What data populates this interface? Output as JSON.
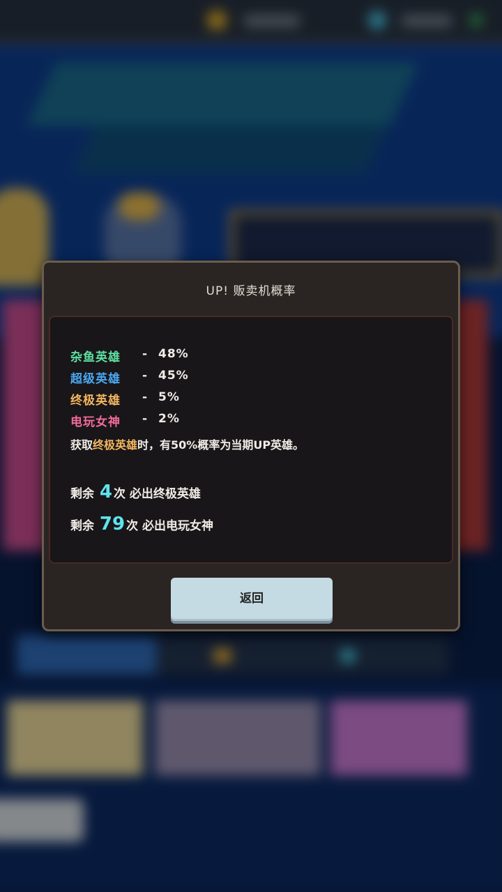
{
  "dialog": {
    "title": "UP! 贩卖机概率",
    "rates": [
      {
        "name": "杂鱼英雄",
        "dash": "-",
        "value": "48%",
        "color": "#5ee0a1"
      },
      {
        "name": "超级英雄",
        "dash": "-",
        "value": "45%",
        "color": "#4aa8f0"
      },
      {
        "name": "终极英雄",
        "dash": "-",
        "value": "5%",
        "color": "#f3b560"
      },
      {
        "name": "电玩女神",
        "dash": "-",
        "value": "2%",
        "color": "#f06a9a"
      }
    ],
    "note": {
      "prefix": "获取",
      "highlight": "终极英雄",
      "suffix": "时，有50%概率为当期UP英雄。"
    },
    "pity": [
      {
        "prefix": "剩余",
        "count": "4",
        "suffix": "次 必出终极英雄"
      },
      {
        "prefix": "剩余",
        "count": "79",
        "suffix": "次 必出电玩女神"
      }
    ],
    "back_label": "返回"
  }
}
